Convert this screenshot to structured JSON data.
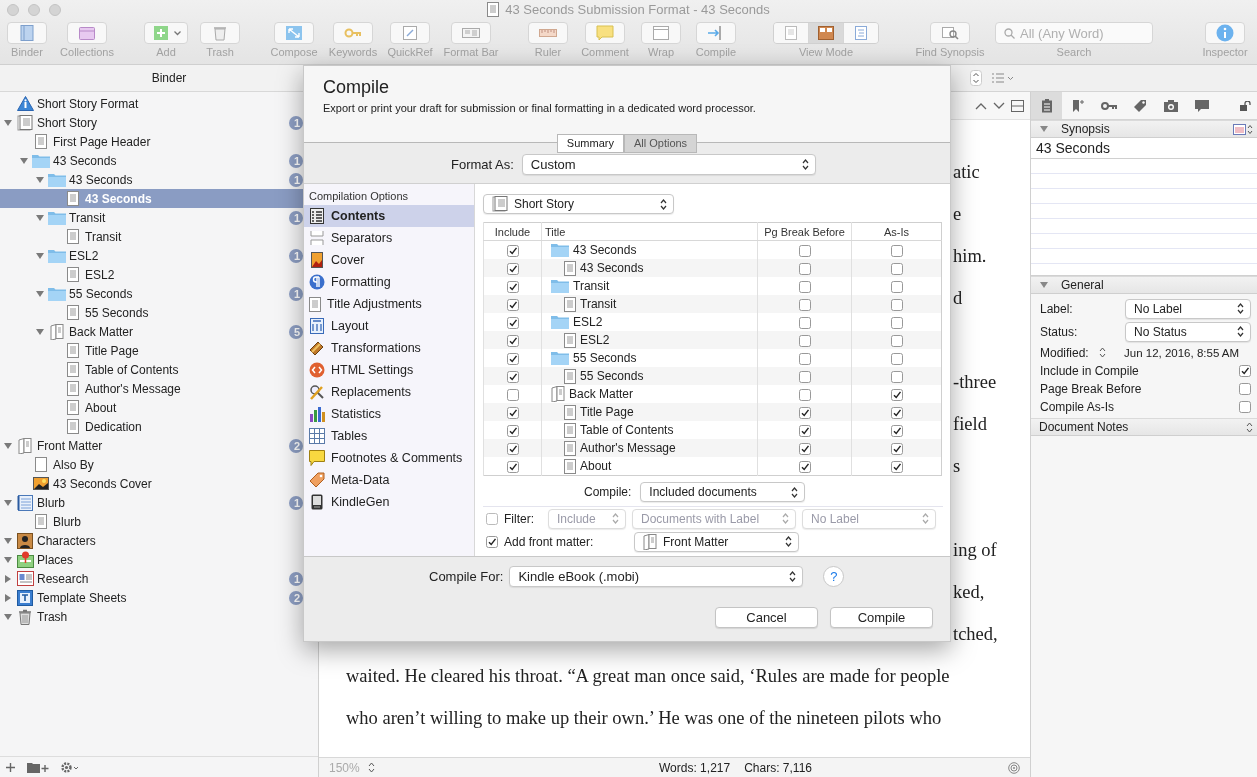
{
  "window": {
    "title": "43 Seconds Submission Format - 43 Seconds"
  },
  "toolbar": [
    {
      "label": "Binder",
      "kind": "binder"
    },
    {
      "label": "Collections",
      "kind": "collections"
    },
    {
      "label": "Add",
      "kind": "add"
    },
    {
      "label": "Trash",
      "kind": "trash"
    },
    {
      "label": "Compose",
      "kind": "compose"
    },
    {
      "label": "Keywords",
      "kind": "keywords"
    },
    {
      "label": "QuickRef",
      "kind": "quickref"
    },
    {
      "label": "Format Bar",
      "kind": "formatbar"
    },
    {
      "label": "Ruler",
      "kind": "ruler"
    },
    {
      "label": "Comment",
      "kind": "comment"
    },
    {
      "label": "Wrap",
      "kind": "wrap"
    },
    {
      "label": "Compile",
      "kind": "compile"
    },
    {
      "label": "View Mode",
      "kind": "viewmode",
      "segments": [
        {
          "selected": false
        },
        {
          "selected": true
        },
        {
          "selected": false
        }
      ]
    },
    {
      "label": "Find Synopsis",
      "kind": "findsynopsis"
    },
    {
      "label": "Search",
      "kind": "search",
      "placeholder": "All (Any Word)"
    },
    {
      "label": "Inspector",
      "kind": "inspector"
    }
  ],
  "binder": {
    "header": "Binder",
    "items": [
      {
        "label": "Short Story Format",
        "kind": "format",
        "selected": false
      },
      {
        "label": "Short Story",
        "kind": "draft",
        "selected": false,
        "expanded": true,
        "badge": "1",
        "children": [
          {
            "label": "First Page Header",
            "kind": "document",
            "selected": false
          },
          {
            "label": "43 Seconds",
            "kind": "folder",
            "selected": false,
            "expanded": true,
            "badge": "1",
            "children": [
              {
                "label": "43 Seconds",
                "kind": "folder",
                "selected": false,
                "expanded": true,
                "badge": "1",
                "children": [
                  {
                    "label": "43 Seconds",
                    "kind": "document",
                    "selected": true
                  }
                ]
              },
              {
                "label": "Transit",
                "kind": "folder",
                "selected": false,
                "expanded": true,
                "badge": "1",
                "children": [
                  {
                    "label": "Transit",
                    "kind": "document",
                    "selected": false
                  }
                ]
              },
              {
                "label": "ESL2",
                "kind": "folder",
                "selected": false,
                "expanded": true,
                "badge": "1",
                "children": [
                  {
                    "label": "ESL2",
                    "kind": "document",
                    "selected": false
                  }
                ]
              },
              {
                "label": "55 Seconds",
                "kind": "folder",
                "selected": false,
                "expanded": true,
                "badge": "1",
                "children": [
                  {
                    "label": "55 Seconds",
                    "kind": "document",
                    "selected": false
                  }
                ]
              },
              {
                "label": "Back Matter",
                "kind": "matter",
                "selected": false,
                "expanded": true,
                "badge": "5",
                "children": [
                  {
                    "label": "Title Page",
                    "kind": "document",
                    "selected": false
                  },
                  {
                    "label": "Table of Contents",
                    "kind": "document",
                    "selected": false
                  },
                  {
                    "label": "Author's Message",
                    "kind": "document",
                    "selected": false
                  },
                  {
                    "label": "About",
                    "kind": "document",
                    "selected": false
                  },
                  {
                    "label": "Dedication",
                    "kind": "document",
                    "selected": false
                  }
                ]
              }
            ]
          }
        ]
      },
      {
        "label": "Front Matter",
        "kind": "matter",
        "selected": false,
        "expanded": true,
        "badge": "2",
        "children": [
          {
            "label": "Also By",
            "kind": "blank",
            "selected": false
          },
          {
            "label": "43 Seconds Cover",
            "kind": "image",
            "selected": false
          }
        ]
      },
      {
        "label": "Blurb",
        "kind": "notebook",
        "selected": false,
        "expanded": true,
        "badge": "1",
        "children": [
          {
            "label": "Blurb",
            "kind": "document",
            "selected": false
          }
        ]
      },
      {
        "label": "Characters",
        "kind": "characters",
        "selected": false,
        "expanded": true
      },
      {
        "label": "Places",
        "kind": "places",
        "selected": false,
        "expanded": true
      },
      {
        "label": "Research",
        "kind": "research",
        "selected": false,
        "expanded": false,
        "badge": "1"
      },
      {
        "label": "Template Sheets",
        "kind": "templates",
        "selected": false,
        "expanded": false,
        "badge": "2"
      },
      {
        "label": "Trash",
        "kind": "trash",
        "selected": false,
        "expanded": true
      }
    ]
  },
  "editor": {
    "lines": [
      {
        "text": "atic",
        "kind": "fragment"
      },
      {
        "text": "e",
        "kind": "fragment"
      },
      {
        "text": "him.",
        "kind": "fragment"
      },
      {
        "text": "d",
        "kind": "fragment"
      },
      {
        "text": "-three",
        "kind": "fragment",
        "blank_before": true
      },
      {
        "text": "field",
        "kind": "fragment"
      },
      {
        "text": "s",
        "kind": "fragment"
      },
      {
        "text": "ing of",
        "kind": "fragment",
        "blank_before": true
      },
      {
        "text": "ked,",
        "kind": "fragment"
      },
      {
        "text": "tched,",
        "kind": "fragment"
      },
      {
        "text": "waited. He cleared his throat. “A great man once said, ‘Rules are made for people",
        "kind": "line"
      },
      {
        "text": "who aren’t willing to make up their own.’ He was one of the nineteen pilots who",
        "kind": "line"
      }
    ],
    "zoom": "150%",
    "words": "Words: 1,217",
    "chars": "Chars: 7,116"
  },
  "inspector": {
    "tabs": [
      {
        "kind": "notes",
        "selected": true
      },
      {
        "kind": "bookmark",
        "selected": false
      },
      {
        "kind": "key",
        "selected": false
      },
      {
        "kind": "tag",
        "selected": false
      },
      {
        "kind": "camera",
        "selected": false
      },
      {
        "kind": "comment",
        "selected": false
      }
    ],
    "synopsis_header": "Synopsis",
    "synopsis": "43 Seconds",
    "general_header": "General",
    "fields": [
      {
        "label": "Label:",
        "value": "No Label"
      },
      {
        "label": "Status:",
        "value": "No Status"
      }
    ],
    "modified_label": "Modified:",
    "modified": "Jun 12, 2016, 8:55 AM",
    "options": [
      {
        "label": "Include in Compile",
        "checked": true
      },
      {
        "label": "Page Break Before",
        "checked": false
      },
      {
        "label": "Compile As-Is",
        "checked": false
      }
    ],
    "notes_header": "Document Notes"
  },
  "compile": {
    "title": "Compile",
    "subtitle": "Export or print your draft for submission or final formatting in a dedicated word processor.",
    "tabs": [
      {
        "label": "Summary",
        "selected": false
      },
      {
        "label": "All Options",
        "selected": true
      }
    ],
    "format_label": "Format As:",
    "format": "Custom",
    "options_header": "Compilation Options",
    "options": [
      {
        "label": "Contents",
        "kind": "contents",
        "selected": true
      },
      {
        "label": "Separators",
        "kind": "separators",
        "selected": false
      },
      {
        "label": "Cover",
        "kind": "cover",
        "selected": false
      },
      {
        "label": "Formatting",
        "kind": "formatting",
        "selected": false
      },
      {
        "label": "Title Adjustments",
        "kind": "titles",
        "selected": false
      },
      {
        "label": "Layout",
        "kind": "layout",
        "selected": false
      },
      {
        "label": "Transformations",
        "kind": "transformations",
        "selected": false
      },
      {
        "label": "HTML Settings",
        "kind": "html",
        "selected": false
      },
      {
        "label": "Replacements",
        "kind": "replacements",
        "selected": false
      },
      {
        "label": "Statistics",
        "kind": "statistics",
        "selected": false
      },
      {
        "label": "Tables",
        "kind": "tables",
        "selected": false
      },
      {
        "label": "Footnotes & Comments",
        "kind": "footnotes",
        "selected": false
      },
      {
        "label": "Meta-Data",
        "kind": "metadata",
        "selected": false
      },
      {
        "label": "KindleGen",
        "kind": "kindlegen",
        "selected": false
      }
    ],
    "source": "Short Story",
    "columns": [
      "Include",
      "Title",
      "Pg Break Before",
      "As-Is"
    ],
    "rows": [
      {
        "title": "43 Seconds",
        "kind": "folder",
        "include": true,
        "page_break": false,
        "as_is": false,
        "children": [
          {
            "title": "43 Seconds",
            "kind": "document",
            "include": true,
            "page_break": false,
            "as_is": false
          }
        ]
      },
      {
        "title": "Transit",
        "kind": "folder",
        "include": true,
        "page_break": false,
        "as_is": false,
        "children": [
          {
            "title": "Transit",
            "kind": "document",
            "include": true,
            "page_break": false,
            "as_is": false
          }
        ]
      },
      {
        "title": "ESL2",
        "kind": "folder",
        "include": true,
        "page_break": false,
        "as_is": false,
        "children": [
          {
            "title": "ESL2",
            "kind": "document",
            "include": true,
            "page_break": false,
            "as_is": false
          }
        ]
      },
      {
        "title": "55 Seconds",
        "kind": "folder",
        "include": true,
        "page_break": false,
        "as_is": false,
        "children": [
          {
            "title": "55 Seconds",
            "kind": "document",
            "include": true,
            "page_break": false,
            "as_is": false
          }
        ]
      },
      {
        "title": "Back Matter",
        "kind": "matter",
        "include": false,
        "page_break": false,
        "as_is": true,
        "children": [
          {
            "title": "Title Page",
            "kind": "document",
            "include": true,
            "page_break": true,
            "as_is": true
          },
          {
            "title": "Table of Contents",
            "kind": "document",
            "include": true,
            "page_break": true,
            "as_is": true
          },
          {
            "title": "Author's Message",
            "kind": "document",
            "include": true,
            "page_break": true,
            "as_is": true
          },
          {
            "title": "About",
            "kind": "document",
            "include": true,
            "page_break": true,
            "as_is": true
          }
        ]
      }
    ],
    "compile_label": "Compile:",
    "compile_value": "Included documents",
    "filter": {
      "label": "Filter:",
      "checked": false,
      "disabled": true,
      "mode": "Include",
      "scope": "Documents with Label",
      "value": "No Label"
    },
    "front_matter": {
      "label": "Add front matter:",
      "checked": true,
      "value": "Front Matter"
    },
    "compile_for_label": "Compile For:",
    "compile_for": "Kindle eBook (.mobi)",
    "help": "?",
    "buttons": [
      "Cancel",
      "Compile"
    ]
  }
}
